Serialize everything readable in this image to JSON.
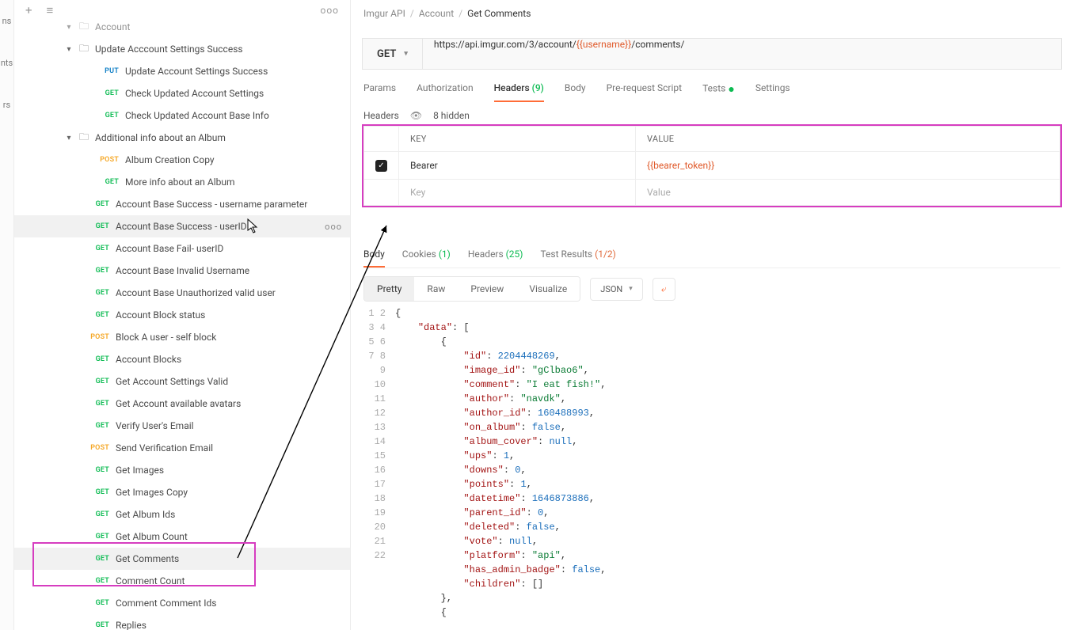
{
  "leftStrip": {
    "items": [
      "ns",
      "nts",
      "rs"
    ]
  },
  "sidebarTop": {
    "plus": "+",
    "filter": "≡",
    "dots": "ooo"
  },
  "tree": {
    "folders": [
      {
        "name": "Account",
        "expanded": true,
        "cutTop": true
      },
      {
        "name": "Update Acccount Settings Success",
        "expanded": true
      },
      {
        "name": "Additional info about an Album",
        "expanded": true
      }
    ],
    "items": [
      {
        "parent": 1,
        "method": "PUT",
        "label": "Update Account Settings Success"
      },
      {
        "parent": 1,
        "method": "GET",
        "label": "Check Updated Account Settings"
      },
      {
        "parent": 1,
        "method": "GET",
        "label": "Check Updated Account Base Info"
      },
      {
        "parent": 2,
        "method": "POST",
        "label": "Album Creation Copy"
      },
      {
        "parent": 2,
        "method": "GET",
        "label": "More info about an Album"
      },
      {
        "parent": 0,
        "method": "GET",
        "label": "Account Base Success - username parameter"
      },
      {
        "parent": 0,
        "method": "GET",
        "label": "Account Base Success - userID",
        "hovered": true
      },
      {
        "parent": 0,
        "method": "GET",
        "label": "Account Base Fail- userID"
      },
      {
        "parent": 0,
        "method": "GET",
        "label": "Account Base Invalid Username"
      },
      {
        "parent": 0,
        "method": "GET",
        "label": "Account Base Unauthorized valid user"
      },
      {
        "parent": 0,
        "method": "GET",
        "label": "Account Block status"
      },
      {
        "parent": 0,
        "method": "POST",
        "label": "Block A user - self block"
      },
      {
        "parent": 0,
        "method": "GET",
        "label": "Account Blocks"
      },
      {
        "parent": 0,
        "method": "GET",
        "label": "Get Account Settings Valid"
      },
      {
        "parent": 0,
        "method": "GET",
        "label": "Get Account available avatars"
      },
      {
        "parent": 0,
        "method": "GET",
        "label": "Verify User's Email"
      },
      {
        "parent": 0,
        "method": "POST",
        "label": "Send Verification Email"
      },
      {
        "parent": 0,
        "method": "GET",
        "label": "Get Images"
      },
      {
        "parent": 0,
        "method": "GET",
        "label": "Get Images Copy"
      },
      {
        "parent": 0,
        "method": "GET",
        "label": "Get Album Ids"
      },
      {
        "parent": 0,
        "method": "GET",
        "label": "Get Album Count"
      },
      {
        "parent": 0,
        "method": "GET",
        "label": "Get Comments",
        "selected": true,
        "boxed": true
      },
      {
        "parent": 0,
        "method": "GET",
        "label": "Comment Count",
        "boxed": true
      },
      {
        "parent": 0,
        "method": "GET",
        "label": "Comment Comment Ids"
      },
      {
        "parent": 0,
        "method": "GET",
        "label": "Replies"
      }
    ]
  },
  "breadcrumb": {
    "a": "Imgur API",
    "b": "Account",
    "c": "Get Comments",
    "sep": "/"
  },
  "request": {
    "method": "GET",
    "urlPre": "https://api.imgur.com/3/account/",
    "urlVar": "{{username}}",
    "urlPost": "/comments/"
  },
  "reqTabs": {
    "params": "Params",
    "auth": "Authorization",
    "headers": "Headers",
    "headersCount": "(9)",
    "body": "Body",
    "pre": "Pre-request Script",
    "tests": "Tests",
    "settings": "Settings"
  },
  "headersSection": {
    "title": "Headers",
    "hidden": "8 hidden",
    "keyHeader": "KEY",
    "valueHeader": "VALUE",
    "row1Key": "Bearer",
    "row1Value": "{{bearer_token}}",
    "keyPlaceholder": "Key",
    "valuePlaceholder": "Value"
  },
  "respTabs": {
    "body": "Body",
    "cookies": "Cookies",
    "cookiesCount": "(1)",
    "headers": "Headers",
    "headersCount": "(25)",
    "tests": "Test Results",
    "testsCount": "(1/2)"
  },
  "viewBar": {
    "pretty": "Pretty",
    "raw": "Raw",
    "preview": "Preview",
    "visualize": "Visualize",
    "format": "JSON"
  },
  "json": {
    "lines": 22,
    "dataKey": "\"data\"",
    "entries": [
      {
        "k": "\"id\"",
        "v": "2204448269",
        "t": "num"
      },
      {
        "k": "\"image_id\"",
        "v": "\"gClbao6\"",
        "t": "str"
      },
      {
        "k": "\"comment\"",
        "v": "\"I eat fish!\"",
        "t": "str"
      },
      {
        "k": "\"author\"",
        "v": "\"navdk\"",
        "t": "str"
      },
      {
        "k": "\"author_id\"",
        "v": "160488993",
        "t": "num"
      },
      {
        "k": "\"on_album\"",
        "v": "false",
        "t": "bool"
      },
      {
        "k": "\"album_cover\"",
        "v": "null",
        "t": "null"
      },
      {
        "k": "\"ups\"",
        "v": "1",
        "t": "num"
      },
      {
        "k": "\"downs\"",
        "v": "0",
        "t": "num"
      },
      {
        "k": "\"points\"",
        "v": "1",
        "t": "num"
      },
      {
        "k": "\"datetime\"",
        "v": "1646873886",
        "t": "num"
      },
      {
        "k": "\"parent_id\"",
        "v": "0",
        "t": "num"
      },
      {
        "k": "\"deleted\"",
        "v": "false",
        "t": "bool"
      },
      {
        "k": "\"vote\"",
        "v": "null",
        "t": "null"
      },
      {
        "k": "\"platform\"",
        "v": "\"api\"",
        "t": "str"
      },
      {
        "k": "\"has_admin_badge\"",
        "v": "false",
        "t": "bool"
      },
      {
        "k": "\"children\"",
        "v": "[]",
        "t": "raw"
      }
    ]
  }
}
